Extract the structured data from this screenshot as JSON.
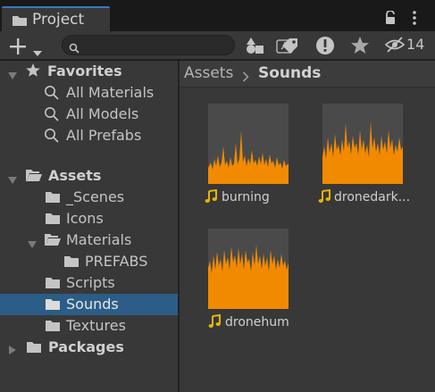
{
  "window": {
    "tab_title": "Project"
  },
  "toolbar": {
    "search": {
      "value": "",
      "placeholder": ""
    },
    "hidden_packages_count": "14"
  },
  "tree": {
    "favorites": {
      "label": "Favorites",
      "items": [
        "All Materials",
        "All Models",
        "All Prefabs"
      ]
    },
    "assets": {
      "label": "Assets",
      "children": {
        "scenes": "_Scenes",
        "icons": "Icons",
        "materials": "Materials",
        "prefabs": "PREFABS",
        "scripts": "Scripts",
        "sounds": "Sounds",
        "textures": "Textures"
      }
    },
    "packages": {
      "label": "Packages"
    },
    "selected": "Sounds"
  },
  "breadcrumb": {
    "root": "Assets",
    "current": "Sounds"
  },
  "assets": [
    {
      "name": "burning"
    },
    {
      "name": "dronedark..."
    },
    {
      "name": "dronehum"
    }
  ],
  "colors": {
    "accent_selection": "#2c5d87",
    "waveform": "#f28a00",
    "audio_icon": "#e8b400",
    "panel": "#383838",
    "tab_highlight": "#3a79bb"
  },
  "icons": [
    "folder-icon",
    "lock-icon",
    "kebab-menu-icon",
    "plus-icon",
    "search-icon",
    "scene-search-icon",
    "type-filter-icon",
    "label-filter-icon",
    "log-filter-icon",
    "star-icon",
    "hidden-eye-icon",
    "magnifier-icon",
    "audio-note-icon",
    "chevron-right-icon",
    "triangle-down-icon",
    "triangle-right-icon"
  ]
}
